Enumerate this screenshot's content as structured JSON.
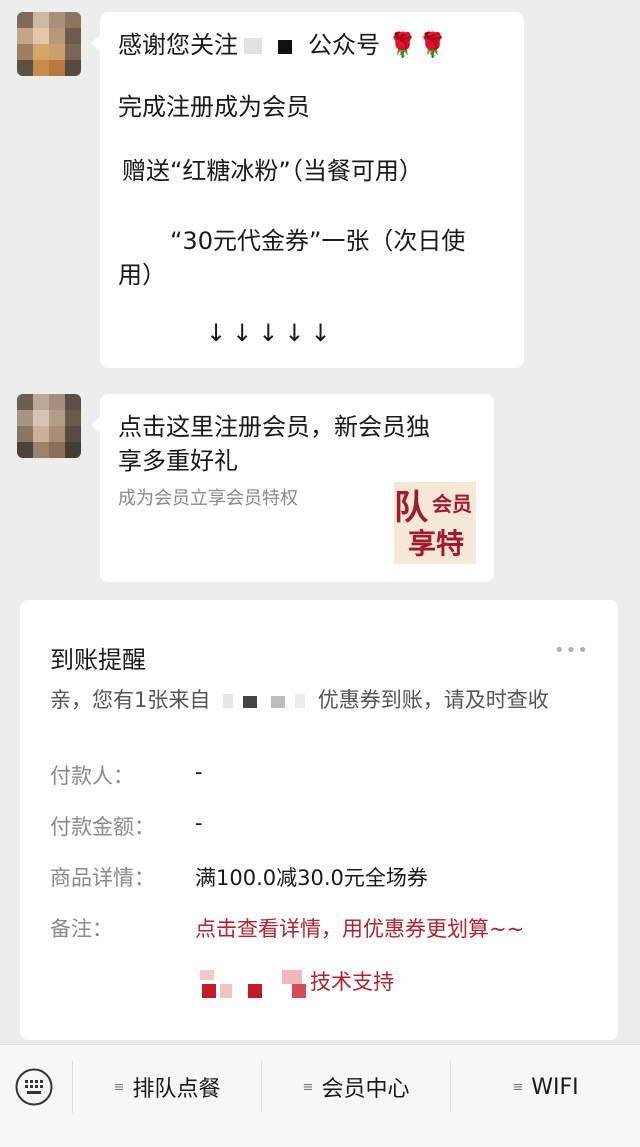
{
  "messages": [
    {
      "lines": [
        {
          "prefix": "感谢您关注",
          "suffix": "公众号"
        },
        "完成注册成为会员",
        "赠送“红糖冰粉”（当餐可用）",
        "“30元代金券”一张（次日使",
        "用）",
        "↓↓↓↓↓"
      ],
      "emoji": "🌹🌹"
    },
    {
      "title_line1": "点击这里注册会员，新会员独",
      "title_line2": "享多重好礼",
      "desc": "成为会员立享会员特权",
      "thumb_text_1": "队",
      "thumb_text_2": "会员",
      "thumb_text_3": "享特"
    }
  ],
  "notice": {
    "title": "到账提醒",
    "more": "•••",
    "intro_prefix": "亲，您有1张来自",
    "intro_suffix": "优惠券到账，请及时查收",
    "rows": [
      {
        "label": "付款人：",
        "value": "-"
      },
      {
        "label": "付款金额：",
        "value": "-"
      },
      {
        "label": "商品详情：",
        "value": "满100.0减30.0元全场券"
      },
      {
        "label": "备注：",
        "value": "点击查看详情，用优惠券更划算~~"
      }
    ],
    "support_suffix": "技术支持"
  },
  "menu": [
    {
      "label": "排队点餐"
    },
    {
      "label": "会员中心"
    },
    {
      "label": "WIFI"
    }
  ],
  "colors": {
    "accent_red": "#b5222b",
    "bg": "#ededed"
  }
}
